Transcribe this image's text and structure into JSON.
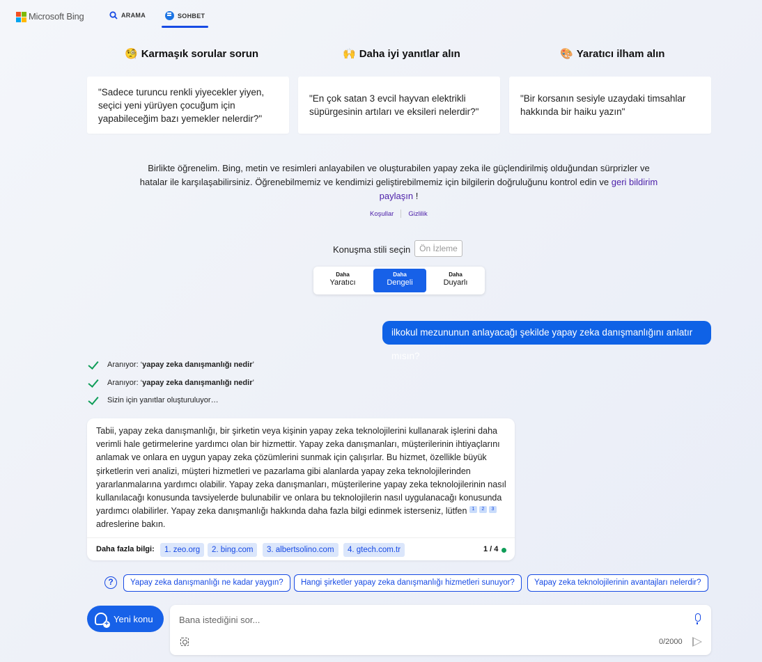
{
  "header": {
    "logo_text": "Microsoft Bing",
    "tabs": [
      {
        "label": "ARAMA",
        "icon": "search-icon"
      },
      {
        "label": "SOHBET",
        "icon": "chat-icon",
        "active": true
      }
    ]
  },
  "features": [
    {
      "emoji": "🧐",
      "title": "Karmaşık sorular sorun",
      "example": "\"Sadece turuncu renkli yiyecekler yiyen, seçici yeni yürüyen çocuğum için yapabileceğim bazı yemekler nelerdir?\""
    },
    {
      "emoji": "🙌",
      "title": "Daha iyi yanıtlar alın",
      "example": "\"En çok satan 3 evcil hayvan elektrikli süpürgesinin artıları ve eksileri nelerdir?\""
    },
    {
      "emoji": "🎨",
      "title": "Yaratıcı ilham alın",
      "example": "\"Bir korsanın sesiyle uzaydaki timsahlar hakkında bir haiku yazın\""
    }
  ],
  "disclaimer": {
    "text": "Birlikte öğrenelim. Bing, metin ve resimleri anlayabilen ve oluşturabilen yapay zeka ile güçlendirilmiş olduğundan sürprizler ve hatalar ile karşılaşabilirsiniz. Öğrenebilmemiz ve kendimizi geliştirebilmemiz için bilgilerin doğruluğunu kontrol edin ve ",
    "link": "geri bildirim paylaşın",
    "suffix": " !",
    "terms": "Koşullar",
    "privacy": "Gizlilik"
  },
  "style": {
    "label": "Konuşma stili seçin",
    "preview": "Ön İzleme",
    "options": [
      {
        "small": "Daha",
        "big": "Yaratıcı"
      },
      {
        "small": "Daha",
        "big": "Dengeli",
        "active": true
      },
      {
        "small": "Daha",
        "big": "Duyarlı"
      }
    ]
  },
  "user_message": "ilkokul mezununun anlayacağı şekilde yapay zeka danışmanlığını anlatır mısın?",
  "status": [
    {
      "prefix": "Aranıyor: ",
      "query": "yapay zeka danışmanlığı nedir"
    },
    {
      "prefix": "Aranıyor: ",
      "query": "yapay zeka danışmanlığı nedir"
    },
    {
      "prefix": "Sizin için yanıtlar oluşturuluyor…",
      "query": ""
    }
  ],
  "answer": {
    "text": "Tabii, yapay zeka danışmanlığı, bir şirketin veya kişinin yapay zeka teknolojilerini kullanarak işlerini daha verimli hale getirmelerine yardımcı olan bir hizmettir. Yapay zeka danışmanları, müşterilerinin ihtiyaçlarını anlamak ve onlara en uygun yapay zeka çözümlerini sunmak için çalışırlar. Bu hizmet, özellikle büyük şirketlerin veri analizi, müşteri hizmetleri ve pazarlama gibi alanlarda yapay zeka teknolojilerinden yararlanmalarına yardımcı olabilir. Yapay zeka danışmanları, müşterilerine yapay zeka teknolojilerinin nasıl kullanılacağı konusunda tavsiyelerde bulunabilir ve onlara bu teknolojilerin nasıl uygulanacağı konusunda yardımcı olabilirler. Yapay zeka danışmanlığı hakkında daha fazla bilgi edinmek isterseniz, lütfen ",
    "citations": [
      "1",
      "2",
      "3"
    ],
    "suffix": " adreslerine bakın.",
    "more_label": "Daha fazla bilgi:",
    "sources": [
      "1. zeo.org",
      "2. bing.com",
      "3. albertsolino.com",
      "4. gtech.com.tr"
    ],
    "counter": "1 / 4"
  },
  "suggestions": [
    "Yapay zeka danışmanlığı ne kadar yaygın?",
    "Hangi şirketler yapay zeka danışmanlığı hizmetleri sunuyor?",
    "Yapay zeka teknolojilerinin avantajları nelerdir?"
  ],
  "composer": {
    "new_topic": "Yeni konu",
    "placeholder": "Bana istediğini sor...",
    "char_count": "0/2000"
  },
  "colors": {
    "accent": "#1761e8",
    "user_bubble": "#0f62e6",
    "link": "#4b1ea8",
    "success": "#0f9d58"
  }
}
